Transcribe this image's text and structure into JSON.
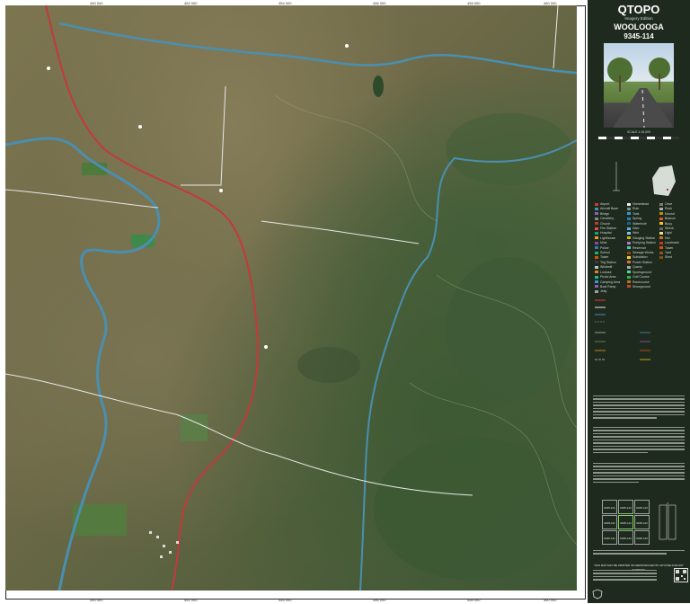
{
  "map": {
    "alt": "aerial imagery of rural hill country with a winding river and roads",
    "top_ticks": [
      "450 000",
      "452 000",
      "454 000",
      "456 000",
      "458 000",
      "460 000"
    ],
    "bottom_ticks": [
      "450 000",
      "452 000",
      "454 000",
      "456 000",
      "458 000",
      "460 000"
    ]
  },
  "sidebar": {
    "brand": "QTOPO",
    "subtitle": "Imagery Edition",
    "map_name": "WOOLOOGA",
    "map_number": "9345-114",
    "scale_label": "SCALE 1:15,000",
    "disclaimer_heading": "THIS MAP MAY BE PRINTED OR REPRODUCED BY ANYONE FOR ANY PURPOSE",
    "legend_left": [
      "Airport",
      "Aircraft Base",
      "Bridge",
      "Cemetery",
      "Church",
      "Fire Station",
      "Hospital",
      "Lighthouse",
      "Mine",
      "Police",
      "School",
      "Tower",
      "Trig Station",
      "Windmill",
      "Lookout",
      "Picnic Area",
      "Camping Area",
      "Boat Ramp",
      "Jetty"
    ],
    "legend_mid": [
      "Homestead",
      "Ruin",
      "Tank",
      "Spring",
      "Waterhole",
      "Dam",
      "Weir",
      "Gauging Station",
      "Pumping Station",
      "Reservoir",
      "Sewage Works",
      "Substation",
      "Power Station",
      "Quarry",
      "Sportsground",
      "Golf Course",
      "Racecourse",
      "Showground"
    ],
    "legend_right": [
      "Cave",
      "Rock",
      "Mound",
      "Beacon",
      "Buoy",
      "Wreck",
      "Light",
      "Hut",
      "Landmark",
      "Tower",
      "Yard",
      "Shed"
    ],
    "index_grid": [
      "9345-121",
      "9345-124",
      "9345-123",
      "9345-111",
      "9345-114",
      "9345-113",
      "9345-141",
      "9345-144",
      "9345-143"
    ]
  },
  "colors": {
    "sidebar_bg": "#1e2a1e",
    "road_red": "#c23a3a",
    "water": "#4a8fb0",
    "road_white": "#e8e8e8"
  }
}
